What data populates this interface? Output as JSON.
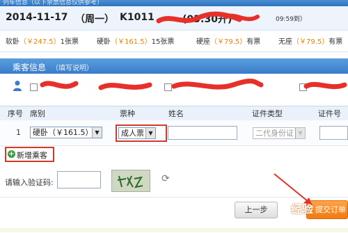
{
  "topbar": {
    "title": "列车信息（以下余票信息仅供参考）"
  },
  "train": {
    "date": "2014-11-17",
    "weekday": "（周一）",
    "number": "K1011",
    "departure": "(03:30开)",
    "arrival_time": "09:59到）"
  },
  "seats": [
    {
      "type": "软卧",
      "price": "（￥247.5）",
      "avail": "1张票"
    },
    {
      "type": "硬卧",
      "price": "（￥161.5）",
      "avail": "15张票"
    },
    {
      "type": "硬座",
      "price": "（￥79.5）",
      "avail": "有票"
    },
    {
      "type": "无座",
      "price": "（￥79.5）",
      "avail": "有票"
    }
  ],
  "passenger_section": {
    "title": "乘客信息",
    "subtitle": "（填写说明）"
  },
  "table": {
    "headers": [
      "序号",
      "席别",
      "票种",
      "姓名",
      "证件类型",
      "证件号码"
    ],
    "row": {
      "no": "1",
      "seat_select": "硬卧（￥161.5）",
      "ticket_type": "成人票",
      "name": "",
      "id_type": "二代身份证",
      "id_number": ""
    }
  },
  "add_passenger": {
    "label": "新增乘客"
  },
  "captcha": {
    "label": "请输入验证码:",
    "value": "",
    "image_text": "tzZt"
  },
  "buttons": {
    "prev": "上一步",
    "submit": "提交订单"
  },
  "watermark": "经验",
  "colors": {
    "header_blue": "#3a7cc8",
    "price_orange": "#f08000",
    "highlight_red": "#d03a2a",
    "submit_orange": "#f07a10"
  }
}
